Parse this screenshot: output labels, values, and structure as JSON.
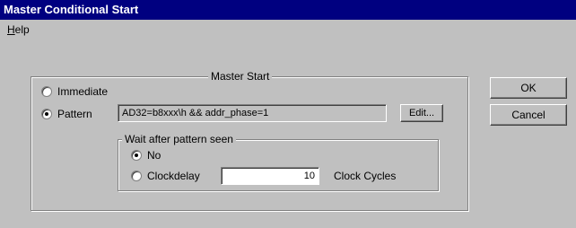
{
  "window": {
    "title": "Master Conditional Start"
  },
  "menu": {
    "help_label": "Help",
    "help_mnemonic": "H",
    "help_rest": "elp"
  },
  "master_start": {
    "label": "Master Start",
    "immediate_label": "Immediate",
    "pattern_label": "Pattern",
    "pattern_value": "AD32=b8xxx\\h && addr_phase=1",
    "edit_label": "Edit...",
    "selected": "pattern"
  },
  "wait": {
    "label": "Wait after pattern seen",
    "no_label": "No",
    "clockdelay_label": "Clockdelay",
    "clockdelay_value": "10",
    "clock_cycles_label": "Clock Cycles",
    "selected": "no"
  },
  "buttons": {
    "ok_label": "OK",
    "cancel_label": "Cancel"
  }
}
